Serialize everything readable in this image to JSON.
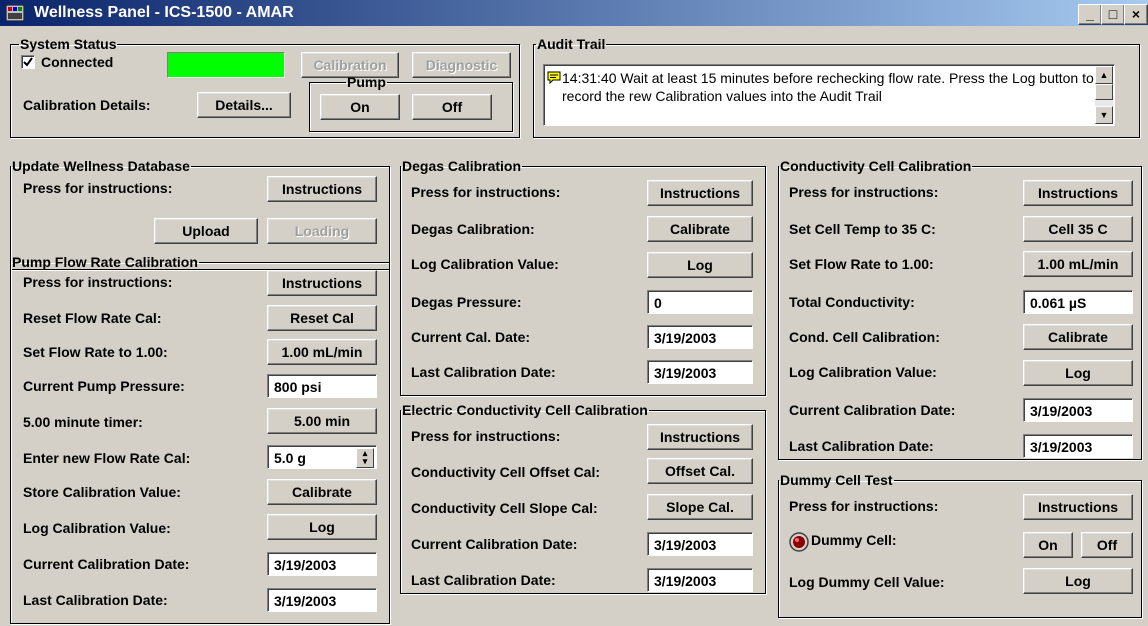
{
  "window": {
    "title": "Wellness Panel - ICS-1500 - AMAR",
    "minimize": "_",
    "maximize": "□",
    "close": "×"
  },
  "system_status": {
    "legend": "System Status",
    "connected_label": "Connected",
    "connected_checked": true,
    "status_color": "#00ff00",
    "calibration_button": "Calibration",
    "diagnostic_button": "Diagnostic",
    "calibration_details_label": "Calibration Details:",
    "details_button": "Details...",
    "pump_legend": "Pump",
    "pump_on": "On",
    "pump_off": "Off"
  },
  "audit_trail": {
    "legend": "Audit Trail",
    "message": "14:31:40 Wait at least 15 minutes before rechecking flow rate. Press the Log button to record the rew Calibration values into the Audit Trail"
  },
  "update_db": {
    "legend": "Update Wellness Database",
    "instructions_label": "Press for instructions:",
    "instructions_button": "Instructions",
    "upload_button": "Upload",
    "loading_button": "Loading"
  },
  "pump_flow": {
    "legend": "Pump Flow Rate Calibration",
    "instructions_label": "Press for instructions:",
    "instructions_button": "Instructions",
    "reset_label": "Reset Flow Rate Cal:",
    "reset_button": "Reset Cal",
    "set_flow_label": "Set Flow Rate to 1.00:",
    "set_flow_button": "1.00 mL/min",
    "pressure_label": "Current Pump Pressure:",
    "pressure_value": "800 psi",
    "timer_label": "5.00 minute timer:",
    "timer_button": "5.00 min",
    "enter_cal_label": "Enter new Flow Rate Cal:",
    "enter_cal_value": "5.0 g",
    "store_label": "Store Calibration Value:",
    "store_button": "Calibrate",
    "log_label": "Log Calibration Value:",
    "log_button": "Log",
    "current_date_label": "Current Calibration Date:",
    "current_date_value": "3/19/2003",
    "last_date_label": "Last Calibration Date:",
    "last_date_value": "3/19/2003"
  },
  "degas": {
    "legend": "Degas Calibration",
    "instructions_label": "Press for instructions:",
    "instructions_button": "Instructions",
    "calibration_label": "Degas Calibration:",
    "calibrate_button": "Calibrate",
    "log_label": "Log Calibration Value:",
    "log_button": "Log",
    "pressure_label": "Degas Pressure:",
    "pressure_value": "0",
    "current_date_label": "Current Cal. Date:",
    "current_date_value": "3/19/2003",
    "last_date_label": "Last Calibration Date:",
    "last_date_value": "3/19/2003"
  },
  "electric_cond": {
    "legend": "Electric Conductivity Cell Calibration",
    "instructions_label": "Press for instructions:",
    "instructions_button": "Instructions",
    "offset_label": "Conductivity Cell Offset Cal:",
    "offset_button": "Offset Cal.",
    "slope_label": "Conductivity Cell Slope Cal:",
    "slope_button": "Slope Cal.",
    "current_date_label": "Current Calibration Date:",
    "current_date_value": "3/19/2003",
    "last_date_label": "Last Calibration Date:",
    "last_date_value": "3/19/2003"
  },
  "cond_cell": {
    "legend": "Conductivity Cell Calibration",
    "instructions_label": "Press for instructions:",
    "instructions_button": "Instructions",
    "cell_temp_label": "Set Cell Temp to 35 C:",
    "cell_temp_button": "Cell 35 C",
    "set_flow_label": "Set Flow Rate to 1.00:",
    "set_flow_button": "1.00 mL/min",
    "total_label": "Total Conductivity:",
    "total_value": "0.061 µS",
    "calibration_label": "Cond. Cell Calibration:",
    "calibrate_button": "Calibrate",
    "log_label": "Log Calibration Value:",
    "log_button": "Log",
    "current_date_label": "Current Calibration Date:",
    "current_date_value": "3/19/2003",
    "last_date_label": "Last Calibration Date:",
    "last_date_value": "3/19/2003"
  },
  "dummy_cell": {
    "legend": "Dummy Cell Test",
    "instructions_label": "Press for instructions:",
    "instructions_button": "Instructions",
    "dummy_label": "Dummy Cell:",
    "on_button": "On",
    "off_button": "Off",
    "log_label": "Log Dummy Cell Value:",
    "log_button": "Log"
  }
}
